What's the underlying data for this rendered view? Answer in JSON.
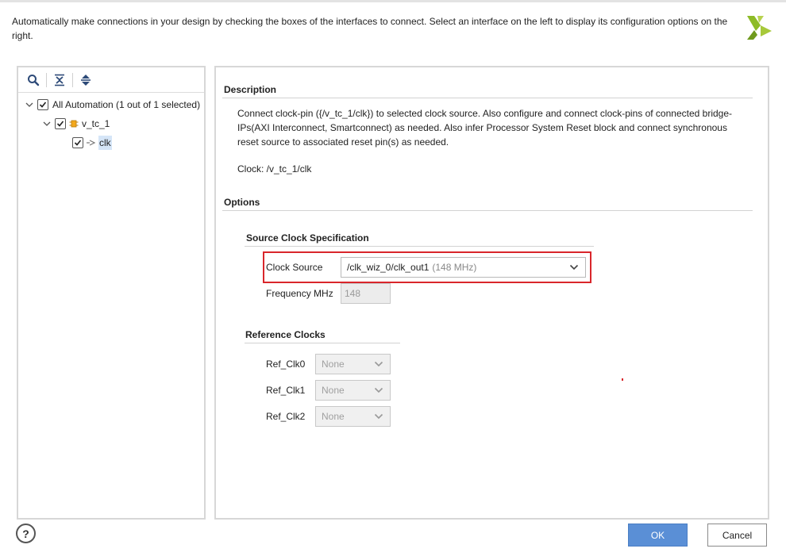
{
  "header": {
    "instructions": "Automatically make connections in your design by checking the boxes of the interfaces to connect. Select an interface on the left to display its configuration options on the right."
  },
  "icons": {
    "logo": "xilinx-logo-icon",
    "search": "search-icon",
    "collapse_all": "collapse-all-icon",
    "expand_all": "expand-all-icon",
    "help": "help-icon"
  },
  "tree": {
    "root": {
      "label": "All Automation (1 out of 1 selected)",
      "checked": true,
      "expanded": true
    },
    "ip": {
      "label": "v_tc_1",
      "checked": true,
      "expanded": true
    },
    "pin": {
      "label": "clk",
      "checked": true,
      "selected": true
    }
  },
  "description": {
    "title": "Description",
    "text": "Connect clock-pin ({/v_tc_1/clk}) to selected clock source. Also configure and connect clock-pins of connected bridge-IPs(AXI Interconnect, Smartconnect) as needed. Also infer Processor System Reset block and connect synchronous reset source to associated reset pin(s) as needed.",
    "clock_line": "Clock: /v_tc_1/clk"
  },
  "options": {
    "title": "Options",
    "source_clock": {
      "title": "Source Clock Specification",
      "clock_source_label": "Clock Source",
      "clock_source_value": "/clk_wiz_0/clk_out1",
      "clock_source_freq": "(148 MHz)",
      "frequency_label": "Frequency MHz",
      "frequency_value": "148"
    },
    "reference_clocks": {
      "title": "Reference Clocks",
      "items": [
        {
          "label": "Ref_Clk0",
          "value": "None"
        },
        {
          "label": "Ref_Clk1",
          "value": "None"
        },
        {
          "label": "Ref_Clk2",
          "value": "None"
        }
      ]
    }
  },
  "footer": {
    "help_label": "?",
    "ok_label": "OK",
    "cancel_label": "Cancel"
  },
  "colors": {
    "accent": "#5a8fd6",
    "highlight": "#d9262b",
    "logo": "#8dbb27"
  }
}
